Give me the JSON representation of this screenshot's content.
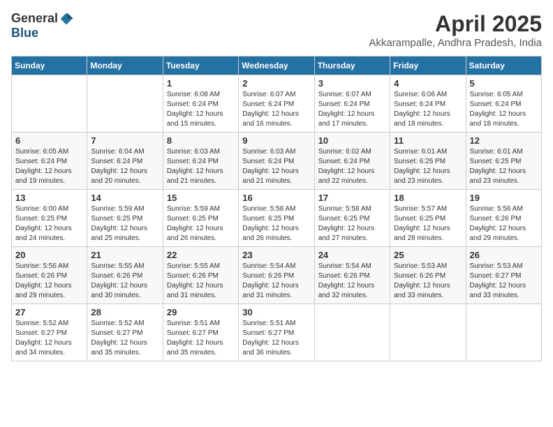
{
  "logo": {
    "general": "General",
    "blue": "Blue"
  },
  "title": "April 2025",
  "location": "Akkarampalle, Andhra Pradesh, India",
  "days_header": [
    "Sunday",
    "Monday",
    "Tuesday",
    "Wednesday",
    "Thursday",
    "Friday",
    "Saturday"
  ],
  "weeks": [
    [
      {
        "day": "",
        "info": ""
      },
      {
        "day": "",
        "info": ""
      },
      {
        "day": "1",
        "sunrise": "Sunrise: 6:08 AM",
        "sunset": "Sunset: 6:24 PM",
        "daylight": "Daylight: 12 hours and 15 minutes."
      },
      {
        "day": "2",
        "sunrise": "Sunrise: 6:07 AM",
        "sunset": "Sunset: 6:24 PM",
        "daylight": "Daylight: 12 hours and 16 minutes."
      },
      {
        "day": "3",
        "sunrise": "Sunrise: 6:07 AM",
        "sunset": "Sunset: 6:24 PM",
        "daylight": "Daylight: 12 hours and 17 minutes."
      },
      {
        "day": "4",
        "sunrise": "Sunrise: 6:06 AM",
        "sunset": "Sunset: 6:24 PM",
        "daylight": "Daylight: 12 hours and 18 minutes."
      },
      {
        "day": "5",
        "sunrise": "Sunrise: 6:05 AM",
        "sunset": "Sunset: 6:24 PM",
        "daylight": "Daylight: 12 hours and 18 minutes."
      }
    ],
    [
      {
        "day": "6",
        "sunrise": "Sunrise: 6:05 AM",
        "sunset": "Sunset: 6:24 PM",
        "daylight": "Daylight: 12 hours and 19 minutes."
      },
      {
        "day": "7",
        "sunrise": "Sunrise: 6:04 AM",
        "sunset": "Sunset: 6:24 PM",
        "daylight": "Daylight: 12 hours and 20 minutes."
      },
      {
        "day": "8",
        "sunrise": "Sunrise: 6:03 AM",
        "sunset": "Sunset: 6:24 PM",
        "daylight": "Daylight: 12 hours and 21 minutes."
      },
      {
        "day": "9",
        "sunrise": "Sunrise: 6:03 AM",
        "sunset": "Sunset: 6:24 PM",
        "daylight": "Daylight: 12 hours and 21 minutes."
      },
      {
        "day": "10",
        "sunrise": "Sunrise: 6:02 AM",
        "sunset": "Sunset: 6:24 PM",
        "daylight": "Daylight: 12 hours and 22 minutes."
      },
      {
        "day": "11",
        "sunrise": "Sunrise: 6:01 AM",
        "sunset": "Sunset: 6:25 PM",
        "daylight": "Daylight: 12 hours and 23 minutes."
      },
      {
        "day": "12",
        "sunrise": "Sunrise: 6:01 AM",
        "sunset": "Sunset: 6:25 PM",
        "daylight": "Daylight: 12 hours and 23 minutes."
      }
    ],
    [
      {
        "day": "13",
        "sunrise": "Sunrise: 6:00 AM",
        "sunset": "Sunset: 6:25 PM",
        "daylight": "Daylight: 12 hours and 24 minutes."
      },
      {
        "day": "14",
        "sunrise": "Sunrise: 5:59 AM",
        "sunset": "Sunset: 6:25 PM",
        "daylight": "Daylight: 12 hours and 25 minutes."
      },
      {
        "day": "15",
        "sunrise": "Sunrise: 5:59 AM",
        "sunset": "Sunset: 6:25 PM",
        "daylight": "Daylight: 12 hours and 26 minutes."
      },
      {
        "day": "16",
        "sunrise": "Sunrise: 5:58 AM",
        "sunset": "Sunset: 6:25 PM",
        "daylight": "Daylight: 12 hours and 26 minutes."
      },
      {
        "day": "17",
        "sunrise": "Sunrise: 5:58 AM",
        "sunset": "Sunset: 6:25 PM",
        "daylight": "Daylight: 12 hours and 27 minutes."
      },
      {
        "day": "18",
        "sunrise": "Sunrise: 5:57 AM",
        "sunset": "Sunset: 6:25 PM",
        "daylight": "Daylight: 12 hours and 28 minutes."
      },
      {
        "day": "19",
        "sunrise": "Sunrise: 5:56 AM",
        "sunset": "Sunset: 6:26 PM",
        "daylight": "Daylight: 12 hours and 29 minutes."
      }
    ],
    [
      {
        "day": "20",
        "sunrise": "Sunrise: 5:56 AM",
        "sunset": "Sunset: 6:26 PM",
        "daylight": "Daylight: 12 hours and 29 minutes."
      },
      {
        "day": "21",
        "sunrise": "Sunrise: 5:55 AM",
        "sunset": "Sunset: 6:26 PM",
        "daylight": "Daylight: 12 hours and 30 minutes."
      },
      {
        "day": "22",
        "sunrise": "Sunrise: 5:55 AM",
        "sunset": "Sunset: 6:26 PM",
        "daylight": "Daylight: 12 hours and 31 minutes."
      },
      {
        "day": "23",
        "sunrise": "Sunrise: 5:54 AM",
        "sunset": "Sunset: 6:26 PM",
        "daylight": "Daylight: 12 hours and 31 minutes."
      },
      {
        "day": "24",
        "sunrise": "Sunrise: 5:54 AM",
        "sunset": "Sunset: 6:26 PM",
        "daylight": "Daylight: 12 hours and 32 minutes."
      },
      {
        "day": "25",
        "sunrise": "Sunrise: 5:53 AM",
        "sunset": "Sunset: 6:26 PM",
        "daylight": "Daylight: 12 hours and 33 minutes."
      },
      {
        "day": "26",
        "sunrise": "Sunrise: 5:53 AM",
        "sunset": "Sunset: 6:27 PM",
        "daylight": "Daylight: 12 hours and 33 minutes."
      }
    ],
    [
      {
        "day": "27",
        "sunrise": "Sunrise: 5:52 AM",
        "sunset": "Sunset: 6:27 PM",
        "daylight": "Daylight: 12 hours and 34 minutes."
      },
      {
        "day": "28",
        "sunrise": "Sunrise: 5:52 AM",
        "sunset": "Sunset: 6:27 PM",
        "daylight": "Daylight: 12 hours and 35 minutes."
      },
      {
        "day": "29",
        "sunrise": "Sunrise: 5:51 AM",
        "sunset": "Sunset: 6:27 PM",
        "daylight": "Daylight: 12 hours and 35 minutes."
      },
      {
        "day": "30",
        "sunrise": "Sunrise: 5:51 AM",
        "sunset": "Sunset: 6:27 PM",
        "daylight": "Daylight: 12 hours and 36 minutes."
      },
      {
        "day": "",
        "info": ""
      },
      {
        "day": "",
        "info": ""
      },
      {
        "day": "",
        "info": ""
      }
    ]
  ]
}
